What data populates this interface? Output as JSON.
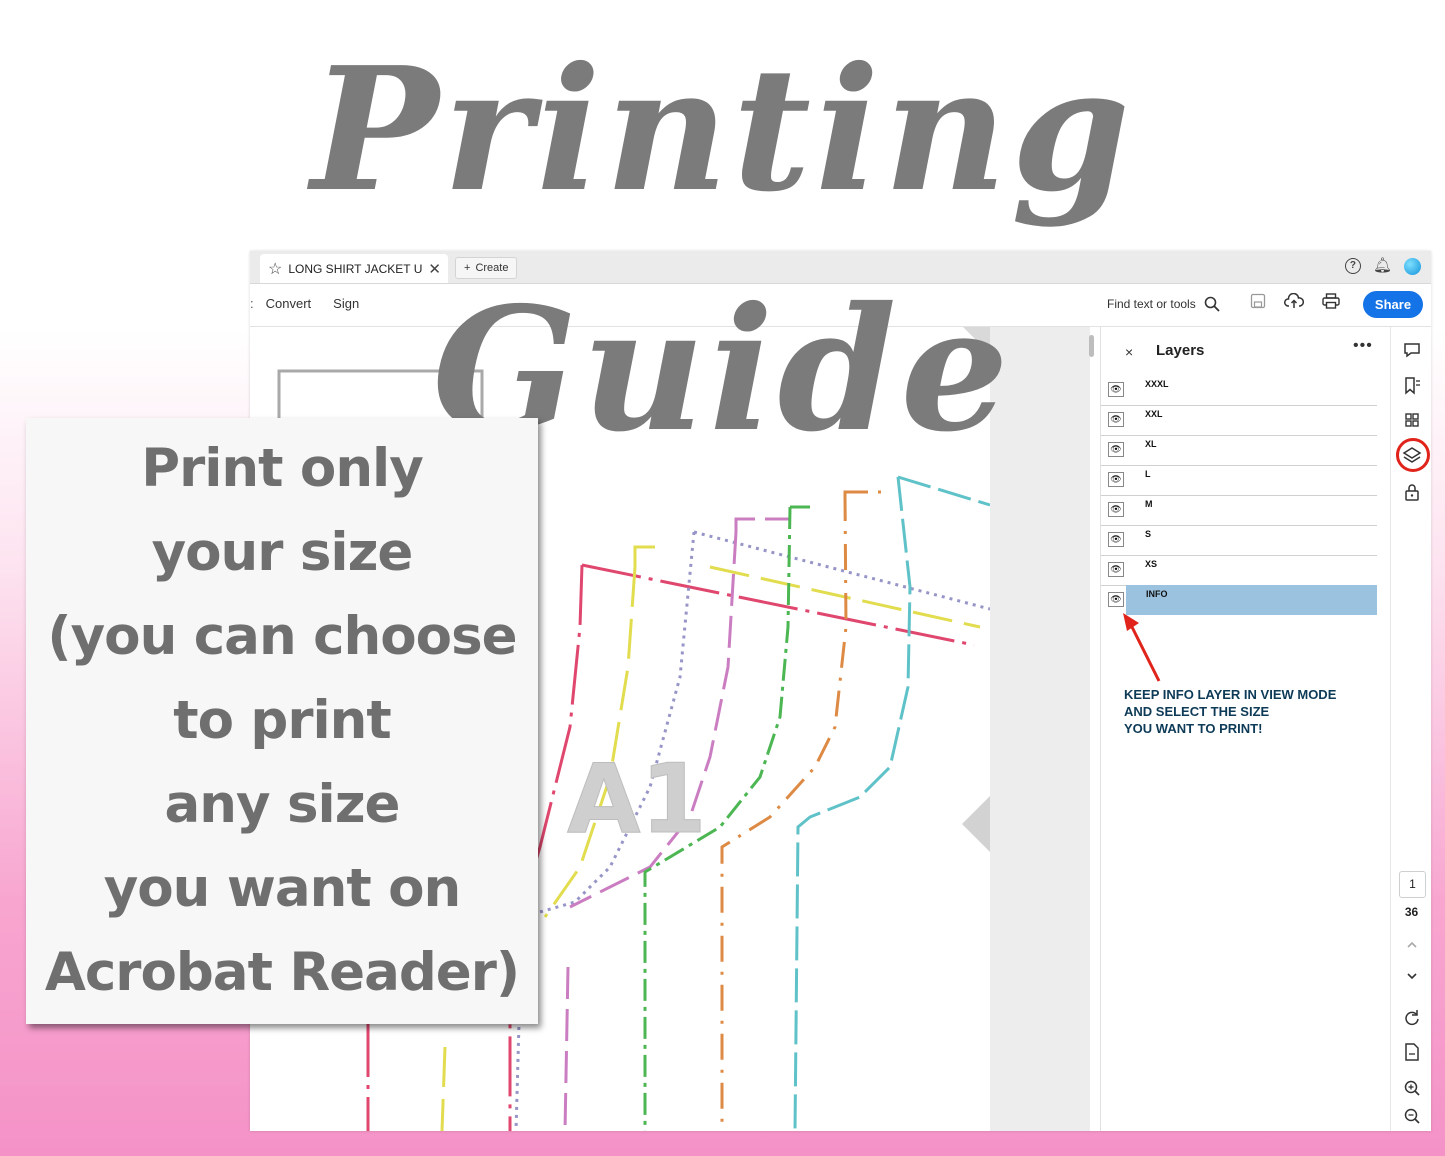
{
  "headline": "Printing Guide",
  "window": {
    "tab_title": "LONG SHIRT JACKET U...",
    "create_label": "Create",
    "menu": [
      "Convert",
      "Sign"
    ],
    "find_label": "Find text or tools",
    "share_label": "Share",
    "help_icon": "?",
    "bell_icon": "bell-icon"
  },
  "document": {
    "watermark": "A1",
    "line_colors": [
      "#e0476f",
      "#e2dd4f",
      "#9795c8",
      "#cb7dc2",
      "#4cb653",
      "#dd8a44",
      "#5fc2c8"
    ]
  },
  "layers_panel": {
    "title": "Layers",
    "close": "×",
    "more": "•••",
    "items": [
      "XXXL",
      "XXL",
      "XL",
      "L",
      "M",
      "S",
      "XS",
      "INFO"
    ],
    "selected": "INFO",
    "annotation": [
      "KEEP INFO LAYER IN VIEW MODE",
      "AND SELECT THE SIZE",
      "YOU WANT TO PRINT!"
    ],
    "highlight_color": "#e0241b",
    "selection_color": "#9bc2df"
  },
  "right_rail": {
    "current_page": "1",
    "total_pages": "36"
  },
  "info_card": {
    "lines": [
      "Print only",
      "your size",
      "(you can choose",
      "to print",
      "any size",
      "you want on",
      "Acrobat Reader)"
    ]
  }
}
